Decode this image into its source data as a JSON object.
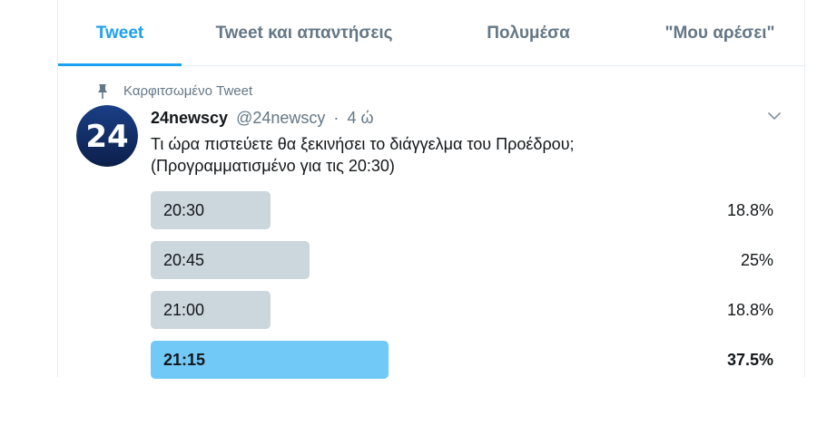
{
  "tabs": [
    {
      "label": "Tweet",
      "active": true
    },
    {
      "label": "Tweet και απαντήσεις",
      "active": false
    },
    {
      "label": "Πολυμέσα",
      "active": false
    },
    {
      "label": "\"Μου αρέσει\"",
      "active": false
    }
  ],
  "tweet": {
    "pinned_label": "Καρφιτσωμένο Tweet",
    "avatar_text": "24",
    "display_name": "24newscy",
    "handle": "@24newscy",
    "separator": "·",
    "time": "4 ώ",
    "text_line1": "Τι ώρα πιστεύετε θα ξεκινήσει το διάγγελμα του Προέδρου;",
    "text_line2": "(Προγραμματισμένο για τις 20:30)"
  },
  "poll": {
    "options": [
      {
        "label": "20:30",
        "percent_text": "18.8%",
        "percent": 18.8,
        "winner": false
      },
      {
        "label": "20:45",
        "percent_text": "25%",
        "percent": 25,
        "winner": false
      },
      {
        "label": "21:00",
        "percent_text": "18.8%",
        "percent": 18.8,
        "winner": false
      },
      {
        "label": "21:15",
        "percent_text": "37.5%",
        "percent": 37.5,
        "winner": true
      }
    ]
  },
  "colors": {
    "accent": "#1da1f2",
    "poll_bar": "#ccd6dd",
    "poll_bar_winner": "#71c9f8",
    "secondary_text": "#657786"
  },
  "icons": {
    "pin": "pin-icon",
    "chevron": "chevron-down-icon"
  }
}
